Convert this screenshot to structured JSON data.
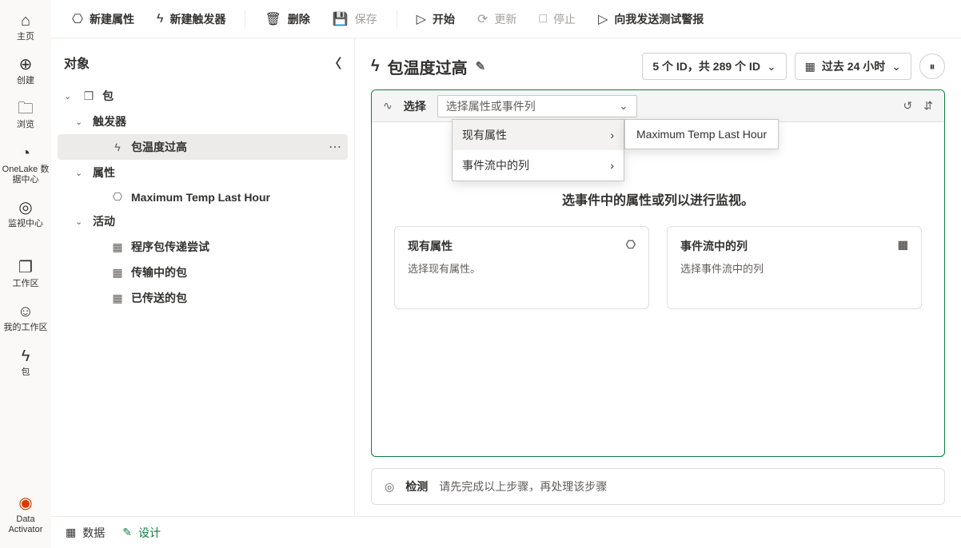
{
  "leftnav": {
    "home": "主页",
    "create": "创建",
    "browse": "浏览",
    "onelake": "OneLake 数据中心",
    "monitor": "监视中心",
    "workspace": "工作区",
    "myworkspace": "我的工作区",
    "package": "包",
    "dataactivator": "Data Activator"
  },
  "toolbar": {
    "new_attr": "新建属性",
    "new_trigger": "新建触发器",
    "delete": "删除",
    "save": "保存",
    "start": "开始",
    "refresh": "更新",
    "stop": "停止",
    "send_alert": "向我发送测试警报"
  },
  "sidebar": {
    "title": "对象",
    "pkg": "包",
    "trigger_group": "触发器",
    "trigger1": "包温度过高",
    "attr_group": "属性",
    "attr1": "Maximum Temp Last Hour",
    "activity_group": "活动",
    "act1": "程序包传递尝试",
    "act2": "传输中的包",
    "act3": "已传送的包"
  },
  "content": {
    "title": "包温度过高",
    "idpill": "5 个 ID，共 289 个 ID",
    "timepill": "过去 24 小时",
    "select_label": "选择",
    "select_placeholder": "选择属性或事件列",
    "dd_existing": "现有属性",
    "dd_eventcol": "事件流中的列",
    "flyout": "Maximum Temp Last Hour",
    "hint": "选事件中的属性或列以进行监视。",
    "card1_title": "现有属性",
    "card1_desc": "选择现有属性。",
    "card2_title": "事件流中的列",
    "card2_desc": "选择事件流中的列",
    "detect_label": "检测",
    "detect_text": "请先完成以上步骤，再处理该步骤"
  },
  "footer": {
    "data": "数据",
    "design": "设计"
  }
}
